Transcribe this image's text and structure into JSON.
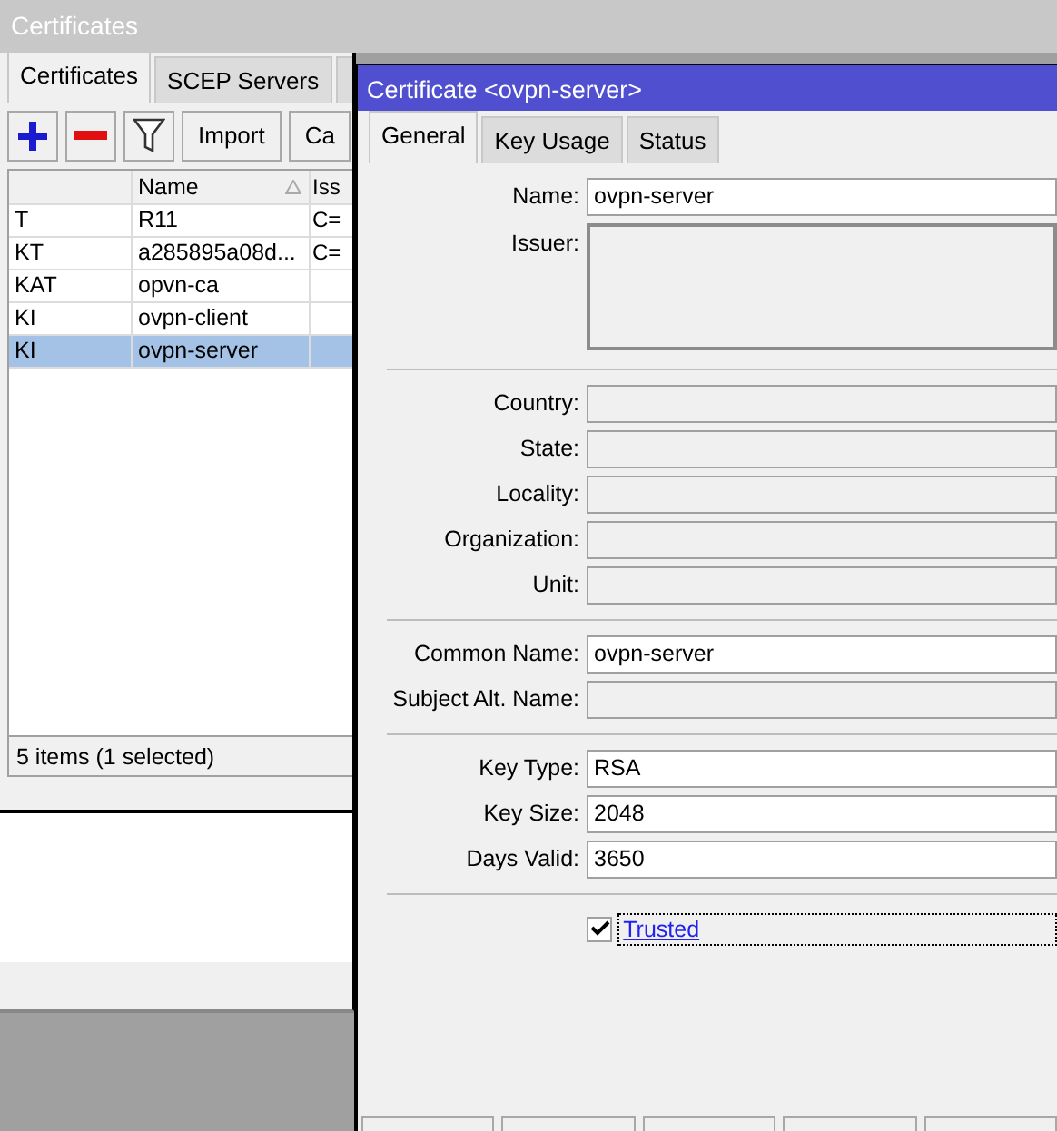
{
  "main_window": {
    "title": "Certificates",
    "tabs": [
      {
        "label": "Certificates",
        "selected": true
      },
      {
        "label": "SCEP Servers",
        "selected": false
      }
    ],
    "toolbar": [
      {
        "kind": "add"
      },
      {
        "kind": "remove"
      },
      {
        "kind": "filter"
      },
      {
        "kind": "text",
        "label": "Import"
      },
      {
        "kind": "text",
        "label": "Ca"
      }
    ],
    "table": {
      "columns": [
        "Name",
        "Iss"
      ],
      "rows": [
        {
          "flags": "T",
          "name": "R11",
          "issuer": "C=",
          "selected": false
        },
        {
          "flags": "KT",
          "name": "a285895a08d...",
          "issuer": "C=",
          "selected": false
        },
        {
          "flags": "KAT",
          "name": "opvn-ca",
          "selected": false
        },
        {
          "flags": "KI",
          "name": "ovpn-client",
          "selected": false
        },
        {
          "flags": "KI",
          "name": "ovpn-server",
          "selected": true
        }
      ]
    },
    "status_bar": "5 items (1 selected)"
  },
  "dialog": {
    "title": "Certificate <ovpn-server>",
    "tabs": [
      {
        "label": "General",
        "selected": true
      },
      {
        "label": "Key Usage",
        "selected": false
      },
      {
        "label": "Status",
        "selected": false
      }
    ],
    "sections": [
      [
        {
          "label": "Name:",
          "value": "ovpn-server"
        },
        {
          "label": "Issuer:",
          "kind": "area"
        }
      ],
      [
        {
          "label": "Country:"
        },
        {
          "label": "State:"
        },
        {
          "label": "Locality:"
        },
        {
          "label": "Organization:"
        },
        {
          "label": "Unit:"
        }
      ],
      [
        {
          "label": "Common Name:",
          "value": "ovpn-server"
        },
        {
          "label": "Subject Alt. Name:"
        }
      ],
      [
        {
          "label": "Key Type:",
          "value": "RSA"
        },
        {
          "label": "Key Size:",
          "value": "2048"
        },
        {
          "label": "Days Valid:",
          "value": "3650"
        }
      ]
    ],
    "trusted": {
      "label": "Trusted",
      "checked": true
    }
  }
}
